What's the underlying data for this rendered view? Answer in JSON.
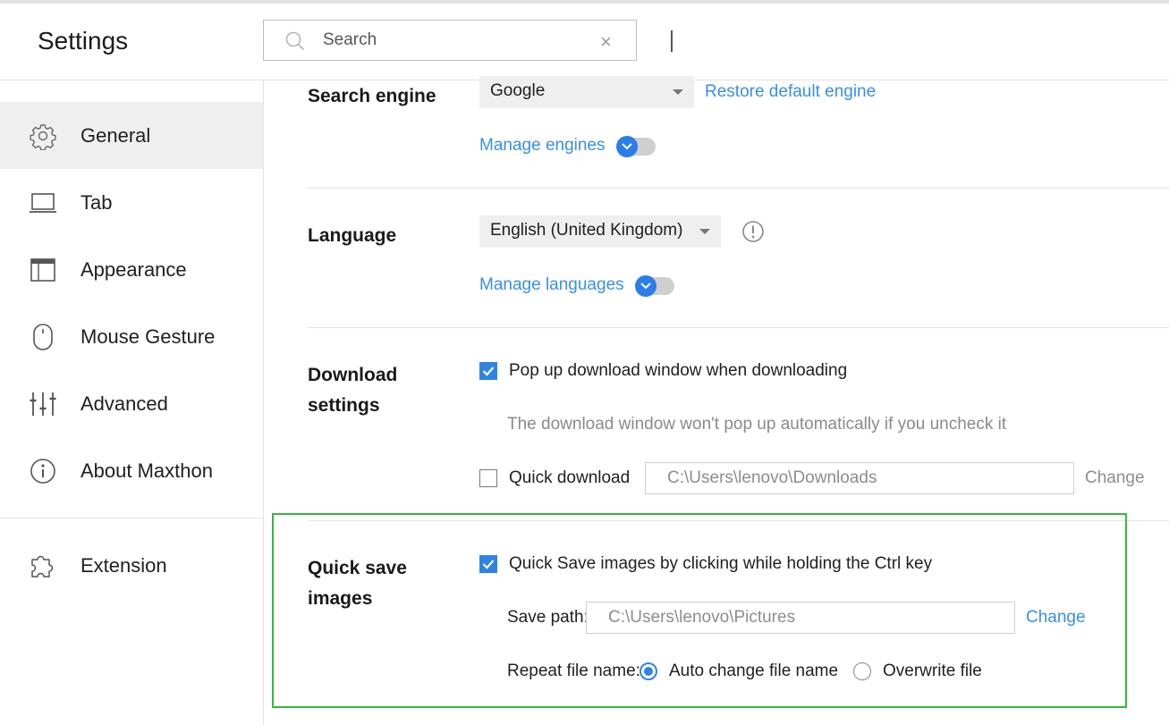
{
  "header": {
    "title": "Settings",
    "search": {
      "placeholder": "Search",
      "value": "",
      "clear": "×"
    }
  },
  "sidebar": {
    "items": [
      {
        "label": "General",
        "icon": "gear-icon",
        "active": true
      },
      {
        "label": "Tab",
        "icon": "laptop-icon"
      },
      {
        "label": "Appearance",
        "icon": "window-icon"
      },
      {
        "label": "Mouse Gesture",
        "icon": "mouse-icon"
      },
      {
        "label": "Advanced",
        "icon": "sliders-icon"
      },
      {
        "label": "About Maxthon",
        "icon": "info-icon"
      }
    ],
    "extension": {
      "label": "Extension",
      "icon": "puzzle-icon"
    }
  },
  "search_engine": {
    "title": "Search engine",
    "selected": "Google",
    "restore_link": "Restore default engine",
    "manage_link": "Manage engines"
  },
  "language": {
    "title": "Language",
    "selected": "English (United Kingdom)",
    "manage_link": "Manage languages"
  },
  "download": {
    "title_line1": "Download",
    "title_line2": "settings",
    "popup_option": {
      "label": "Pop up download window when downloading",
      "checked": true
    },
    "popup_hint": "The download window won't pop up automatically if you uncheck it",
    "quick_download": {
      "label": "Quick download",
      "checked": false,
      "path": "C:\\Users\\lenovo\\Downloads"
    },
    "change_label": "Change"
  },
  "quick_save": {
    "title_line1": "Quick save",
    "title_line2": "images",
    "option": {
      "label": "Quick Save images by clicking while holding the Ctrl key",
      "checked": true
    },
    "save_path_label": "Save path:",
    "save_path": "C:\\Users\\lenovo\\Pictures",
    "change_label": "Change",
    "repeat_label": "Repeat file name:",
    "repeat_options": [
      {
        "label": "Auto change file name",
        "selected": true
      },
      {
        "label": "Overwrite file",
        "selected": false
      }
    ]
  },
  "colors": {
    "accent": "#2f84e3",
    "link": "#3a8ee6",
    "highlight": "#33b83a"
  }
}
